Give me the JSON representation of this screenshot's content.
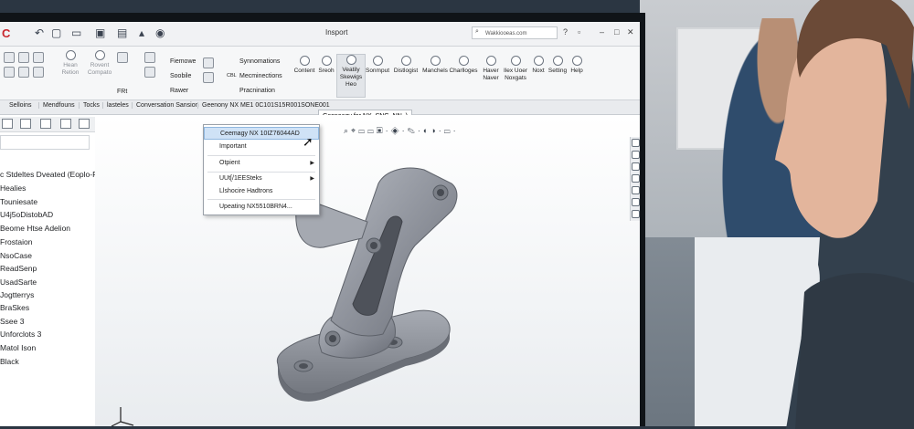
{
  "app": {
    "window_title": "Insport",
    "search_placeholder": "Wakkiooeas.com"
  },
  "ribbon": {
    "left_buttons": [
      "Hean Retion",
      "Rovent Compato"
    ],
    "mid_items": [
      "Fiemowe",
      "Soobile",
      "Rawer"
    ],
    "mid_items2": [
      "Synnomations",
      "Mecminections",
      "Pracnination"
    ],
    "btn_label": "FRt",
    "cbl_label": "CBL",
    "big_buttons": [
      {
        "label": "Content",
        "active": false
      },
      {
        "label": "Sreoh",
        "active": false
      },
      {
        "label": "Veatily Skewigs",
        "sub": "Heo",
        "active": true
      },
      {
        "label": "Sonmput",
        "active": false
      },
      {
        "label": "Distlogist",
        "active": false
      },
      {
        "label": "Manchels",
        "active": false
      },
      {
        "label": "Charlloges",
        "active": false
      },
      {
        "label": "Haver Naver",
        "active": false
      },
      {
        "label": "Ilex Uoer Noxgats",
        "active": false
      },
      {
        "label": "Noxt",
        "active": false
      },
      {
        "label": "Setting",
        "active": false
      },
      {
        "label": "Help",
        "active": false
      }
    ]
  },
  "tabs": [
    {
      "label": "Selloins"
    },
    {
      "label": "Mendfouns"
    },
    {
      "label": "Tocks"
    },
    {
      "label": "lasteles"
    },
    {
      "label": "Conversation Sansion"
    },
    {
      "label": "Geenony NX ME1 0C101S15R001SONE001"
    },
    {
      "label": "Gseneagy for NX_SNG_NN_)"
    }
  ],
  "tree": {
    "header": "c Stdeltes Dveated (Eoplo-Ra",
    "items": [
      "Healies",
      "Touniesate",
      "U4j5oDistobAD",
      "Beome Htse Adelion",
      "Frostaion",
      "NsoCase",
      "ReadSenp",
      "UsadSarte",
      "Jogtterrys",
      "BraSkes",
      "Ssee 3",
      "Unforclots 3",
      "Matol Ison",
      "Black"
    ]
  },
  "context_menu": {
    "items": [
      {
        "label": "Ceemagy NX 10IZ76044AD",
        "highlighted": true,
        "submenu": false
      },
      {
        "label": "Important",
        "highlighted": false,
        "submenu": false
      },
      {
        "label": "Otpient",
        "highlighted": false,
        "submenu": true
      },
      {
        "label": "UUt[/1EESteks",
        "highlighted": false,
        "submenu": true
      },
      {
        "label": "Llshocire Hadtrons",
        "highlighted": false,
        "submenu": false
      },
      {
        "label": "Upeating NX5510BRN4...",
        "highlighted": false,
        "submenu": false
      }
    ]
  },
  "colors": {
    "accent": "#c8272e",
    "menu_highlight": "#cfe2f6",
    "part_gray": "#8f939c"
  },
  "icons": [
    "app-logo-icon",
    "undo-icon",
    "new-file-icon",
    "open-icon",
    "save-icon",
    "print-icon",
    "search-icon",
    "help-icon",
    "minimize-icon",
    "maximize-icon",
    "close-icon",
    "cursor-pointer-icon",
    "triad-axes-icon"
  ]
}
